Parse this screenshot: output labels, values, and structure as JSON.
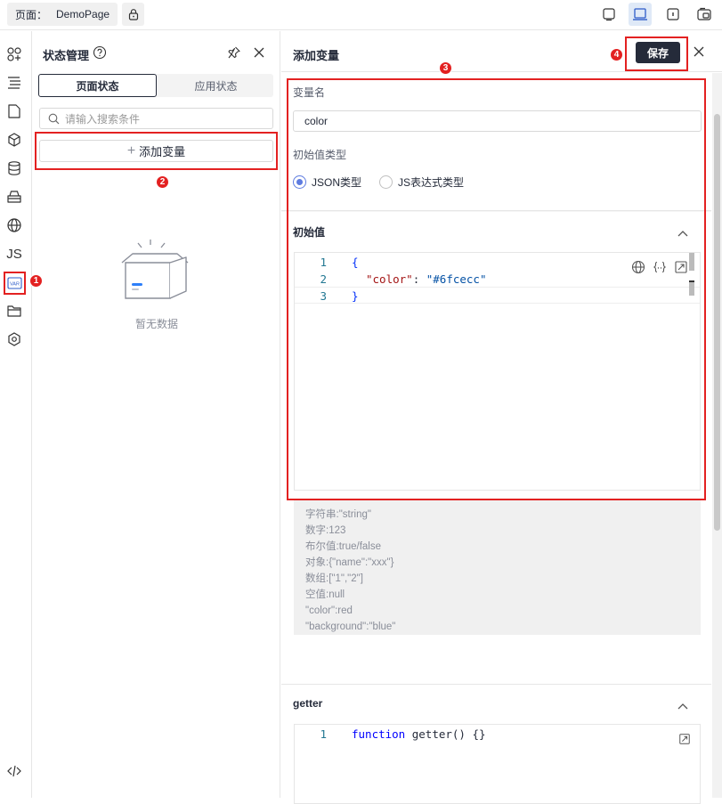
{
  "topbar": {
    "page_label": "页面：",
    "page_name": "DemoPage",
    "lock_icon": "lock-icon",
    "device_icons": [
      "tablet-icon",
      "laptop-icon",
      "mobile-icon",
      "split-view-icon"
    ]
  },
  "leftbar": {
    "items": [
      "components-icon",
      "outline-icon",
      "page-icon",
      "block-icon",
      "datasource-icon",
      "bridge-icon",
      "i18n-icon",
      "js-icon",
      "variable-icon",
      "folder-icon",
      "plugin-icon"
    ],
    "js_label": "JS",
    "var_label": "VAR",
    "bottom_icon": "code-icon"
  },
  "badges": {
    "b1": "1",
    "b2": "2",
    "b3": "3",
    "b4": "4"
  },
  "state_panel": {
    "title": "状态管理",
    "tabs": [
      {
        "label": "页面状态",
        "active": true
      },
      {
        "label": "应用状态",
        "active": false
      }
    ],
    "search_placeholder": "请输入搜索条件",
    "add_button": "添加变量",
    "empty_text": "暂无数据"
  },
  "add_variable": {
    "title": "添加变量",
    "save": "保存",
    "name_label": "变量名",
    "name_value": "color",
    "type_label": "初始值类型",
    "types": [
      {
        "label": "JSON类型",
        "checked": true
      },
      {
        "label": "JS表达式类型",
        "checked": false
      }
    ],
    "initial_section": "初始值",
    "code_lines": [
      "1",
      "2",
      "3"
    ],
    "code_open": "{",
    "code_key": "\"color\"",
    "code_colon": ": ",
    "code_value": "\"#6fcecc\"",
    "code_close": "}",
    "hints": [
      "字符串:\"string\"",
      "数字:123",
      "布尔值:true/false",
      "对象:{\"name\":\"xxx\"}",
      "数组:[\"1\",\"2\"]",
      "空值:null",
      "\"color\":red",
      "\"background\":\"blue\""
    ],
    "getter_section": "getter",
    "getter_line": "1",
    "getter_kw": "function",
    "getter_rest": " getter() {}"
  },
  "colors": {
    "accent": "#5e7ce0",
    "annotation": "#e32121",
    "primary_button": "#252b3a"
  }
}
